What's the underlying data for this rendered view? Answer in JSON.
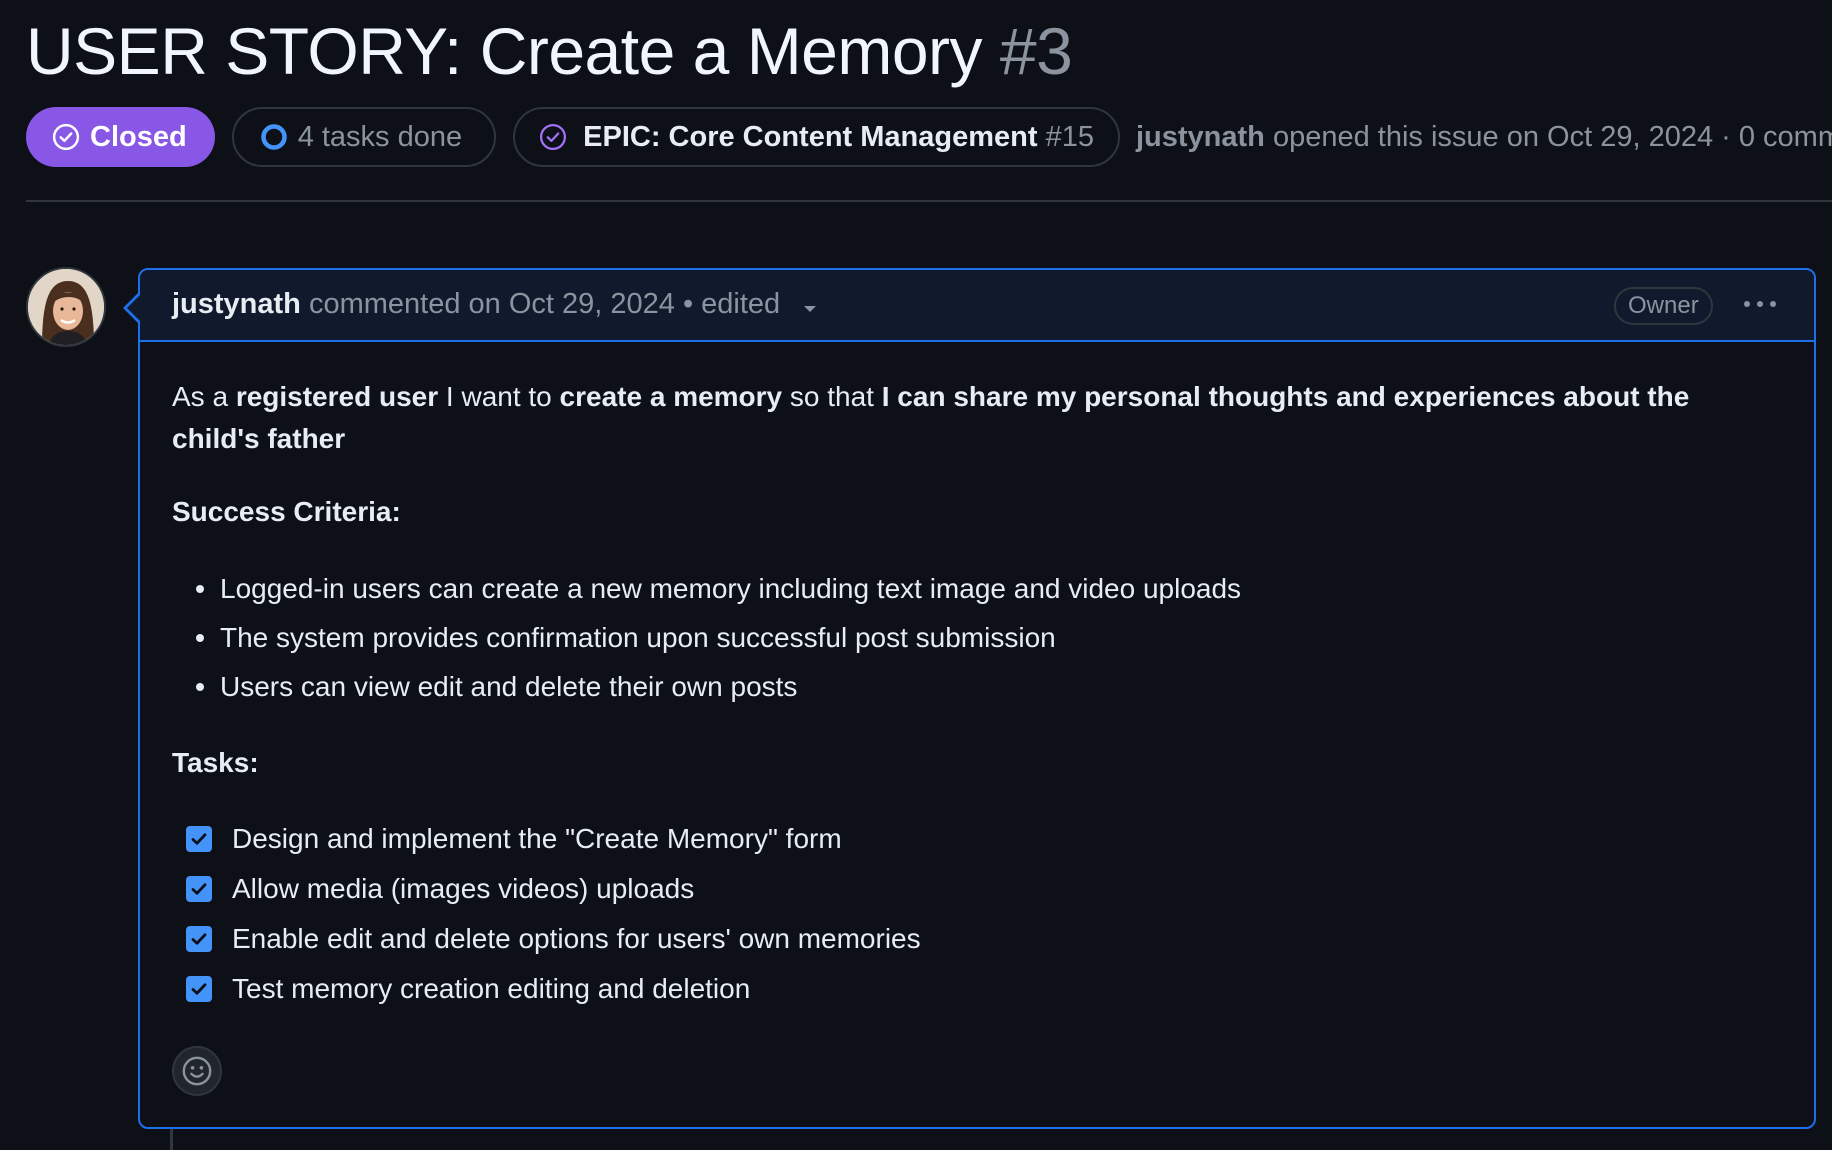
{
  "issue": {
    "title": "USER STORY: Create a Memory",
    "number": "#3"
  },
  "meta": {
    "state_label": "Closed",
    "tasks_label": "4 tasks done",
    "epic_title": "EPIC: Core Content Management",
    "epic_number": "#15",
    "opened_author": "justynath",
    "opened_text": "opened this issue on Oct 29, 2024 · 0 comme"
  },
  "comment": {
    "author": "justynath",
    "meta_text": "commented on Oct 29, 2024 • edited",
    "role_badge": "Owner",
    "story": {
      "t1": "As a ",
      "b1": "registered user",
      "t2": " I want to ",
      "b2": "create a memory",
      "t3": " so that ",
      "b3": "I can share my personal thoughts and experiences about the child's father"
    },
    "criteria_heading": "Success Criteria:",
    "criteria": [
      "Logged-in users can create a new memory including text image and video uploads",
      "The system provides confirmation upon successful post submission",
      "Users can view edit and delete their own posts"
    ],
    "tasks_heading": "Tasks:",
    "tasks": [
      {
        "label": "Design and implement the \"Create Memory\" form",
        "checked": true
      },
      {
        "label": "Allow media (images videos) uploads",
        "checked": true
      },
      {
        "label": "Enable edit and delete options for users' own memories",
        "checked": true
      },
      {
        "label": "Test memory creation editing and deletion",
        "checked": true
      }
    ]
  },
  "colors": {
    "closed_purple": "#8957e5",
    "accent_blue": "#1f6feb",
    "checkbox_blue": "#4493f8",
    "background": "#0d1117"
  },
  "icons": {
    "state": "check-circle-icon",
    "tasks": "progress-circle-icon",
    "epic": "check-circle-outline-icon",
    "more": "kebab-horizontal-icon",
    "reaction": "smiley-icon"
  }
}
